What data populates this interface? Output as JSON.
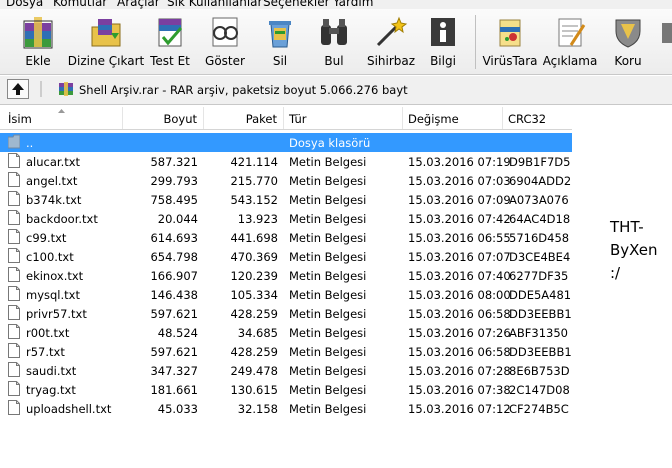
{
  "menu": [
    "Dosya",
    "Komutlar",
    "Araçlar",
    "Sık Kullanılanlar",
    "Seçenekler",
    "Yardım"
  ],
  "toolbar": {
    "buttons": [
      {
        "label": "Ekle",
        "icon": "add-archive-icon"
      },
      {
        "label": "Dizine Çıkart",
        "icon": "extract-to-icon"
      },
      {
        "label": "Test Et",
        "icon": "test-icon"
      },
      {
        "label": "Göster",
        "icon": "view-icon"
      },
      {
        "label": "Sil",
        "icon": "delete-icon"
      },
      {
        "label": "Bul",
        "icon": "find-icon"
      },
      {
        "label": "Sihirbaz",
        "icon": "wizard-icon"
      },
      {
        "label": "Bilgi",
        "icon": "info-icon"
      },
      {
        "label": "VirüsTara",
        "icon": "virus-scan-icon"
      },
      {
        "label": "Açıklama",
        "icon": "comment-icon"
      },
      {
        "label": "Koru",
        "icon": "protect-icon"
      }
    ]
  },
  "address": {
    "text": "Shell Arşiv.rar - RAR arşiv, paketsiz boyut 5.066.276 bayt"
  },
  "columns": [
    "İsim",
    "Boyut",
    "Paket",
    "Tür",
    "Değişme",
    "CRC32"
  ],
  "parent_row": {
    "name": "..",
    "type": "Dosya klasörü"
  },
  "files": [
    {
      "name": "alucar.txt",
      "size": "587.321",
      "packed": "421.114",
      "type": "Metin Belgesi",
      "modified": "15.03.2016 07:19",
      "crc": "D9B1F7D5"
    },
    {
      "name": "angel.txt",
      "size": "299.793",
      "packed": "215.770",
      "type": "Metin Belgesi",
      "modified": "15.03.2016 07:03",
      "crc": "6904ADD2"
    },
    {
      "name": "b374k.txt",
      "size": "758.495",
      "packed": "543.152",
      "type": "Metin Belgesi",
      "modified": "15.03.2016 07:09",
      "crc": "A073A076"
    },
    {
      "name": "backdoor.txt",
      "size": "20.044",
      "packed": "13.923",
      "type": "Metin Belgesi",
      "modified": "15.03.2016 07:42",
      "crc": "64AC4D18"
    },
    {
      "name": "c99.txt",
      "size": "614.693",
      "packed": "441.698",
      "type": "Metin Belgesi",
      "modified": "15.03.2016 06:55",
      "crc": "5716D458"
    },
    {
      "name": "c100.txt",
      "size": "654.798",
      "packed": "470.369",
      "type": "Metin Belgesi",
      "modified": "15.03.2016 07:07",
      "crc": "D3CE4BE4"
    },
    {
      "name": "ekinox.txt",
      "size": "166.907",
      "packed": "120.239",
      "type": "Metin Belgesi",
      "modified": "15.03.2016 07:40",
      "crc": "6277DF35"
    },
    {
      "name": "mysql.txt",
      "size": "146.438",
      "packed": "105.334",
      "type": "Metin Belgesi",
      "modified": "15.03.2016 08:00",
      "crc": "DDE5A481"
    },
    {
      "name": "privr57.txt",
      "size": "597.621",
      "packed": "428.259",
      "type": "Metin Belgesi",
      "modified": "15.03.2016 06:58",
      "crc": "DD3EEBB1"
    },
    {
      "name": "r00t.txt",
      "size": "48.524",
      "packed": "34.685",
      "type": "Metin Belgesi",
      "modified": "15.03.2016 07:26",
      "crc": "ABF31350"
    },
    {
      "name": "r57.txt",
      "size": "597.621",
      "packed": "428.259",
      "type": "Metin Belgesi",
      "modified": "15.03.2016 06:58",
      "crc": "DD3EEBB1"
    },
    {
      "name": "saudi.txt",
      "size": "347.327",
      "packed": "249.478",
      "type": "Metin Belgesi",
      "modified": "15.03.2016 07:28",
      "crc": "8E6B753D"
    },
    {
      "name": "tryag.txt",
      "size": "181.661",
      "packed": "130.615",
      "type": "Metin Belgesi",
      "modified": "15.03.2016 07:38",
      "crc": "2C147D08"
    },
    {
      "name": "uploadshell.txt",
      "size": "45.033",
      "packed": "32.158",
      "type": "Metin Belgesi",
      "modified": "15.03.2016 07:12",
      "crc": "CF274B5C"
    }
  ],
  "side_note": "THT-\nByXen\n:/",
  "colors": {
    "selection": "#3399ff",
    "folder": "#9fb8cf"
  }
}
